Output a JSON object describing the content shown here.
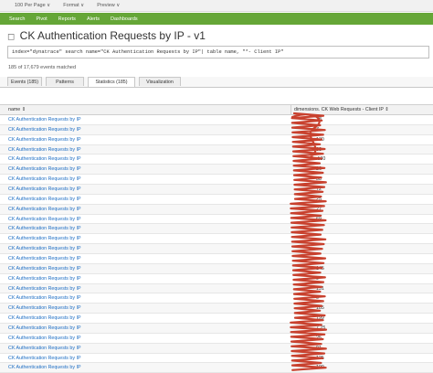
{
  "toolbar": {
    "per_page": "100 Per Page ∨",
    "format": "Format ∨",
    "preview": "Preview ∨"
  },
  "nav": {
    "items": [
      "Search",
      "Pivot",
      "Reports",
      "Alerts",
      "Dashboards"
    ]
  },
  "page": {
    "title": "CK Authentication Requests by IP - v1",
    "collapse_glyph": "◻"
  },
  "search": {
    "query": "index=\"dynatrace\" search name=\"CK Authentication Requests by IP\"| table name, \"*- Client IP\""
  },
  "results": {
    "matched": "185 of 17,679 events matched"
  },
  "tabs": [
    {
      "label": "Events (185)"
    },
    {
      "label": "Patterns"
    },
    {
      "label": "Statistics (185)"
    },
    {
      "label": "Visualization"
    }
  ],
  "table": {
    "columns": [
      "name ⇕",
      "dimensions. CK Web Requests - Client IP ⇕"
    ],
    "rows": [
      {
        "name": "CK Authentication Requests by IP",
        "ip": "28"
      },
      {
        "name": "CK Authentication Requests by IP",
        "ip": "7"
      },
      {
        "name": "CK Authentication Requests by IP",
        "ip": "130"
      },
      {
        "name": "CK Authentication Requests by IP",
        "ip": "30"
      },
      {
        "name": "CK Authentication Requests by IP",
        "ip": ".130"
      },
      {
        "name": "CK Authentication Requests by IP",
        "ip": "26"
      },
      {
        "name": "CK Authentication Requests by IP",
        "ip": "38"
      },
      {
        "name": "CK Authentication Requests by IP",
        "ip": "72"
      },
      {
        "name": "CK Authentication Requests by IP",
        "ip": "25"
      },
      {
        "name": "CK Authentication Requests by IP",
        "ip": "27"
      },
      {
        "name": "CK Authentication Requests by IP",
        "ip": "69"
      },
      {
        "name": "CK Authentication Requests by IP",
        "ip": ""
      },
      {
        "name": "CK Authentication Requests by IP",
        "ip": ""
      },
      {
        "name": "CK Authentication Requests by IP",
        "ip": ""
      },
      {
        "name": "CK Authentication Requests by IP",
        "ip": ""
      },
      {
        "name": "CK Authentication Requests by IP",
        "ip": "145"
      },
      {
        "name": "CK Authentication Requests by IP",
        "ip": "9"
      },
      {
        "name": "CK Authentication Requests by IP",
        "ip": "131"
      },
      {
        "name": "CK Authentication Requests by IP",
        "ip": "0"
      },
      {
        "name": "CK Authentication Requests by IP",
        "ip": "185"
      },
      {
        "name": "CK Authentication Requests by IP",
        "ip": "199"
      },
      {
        "name": "CK Authentication Requests by IP",
        "ip": "7.25"
      },
      {
        "name": "CK Authentication Requests by IP",
        "ip": "25"
      },
      {
        "name": "CK Authentication Requests by IP",
        "ip": "91"
      },
      {
        "name": "CK Authentication Requests by IP",
        "ip": "125"
      },
      {
        "name": "CK Authentication Requests by IP",
        "ip": "199"
      }
    ]
  },
  "colors": {
    "nav_green": "#65a637",
    "link_blue": "#1e6ec4",
    "redaction_red": "#c8412e"
  }
}
